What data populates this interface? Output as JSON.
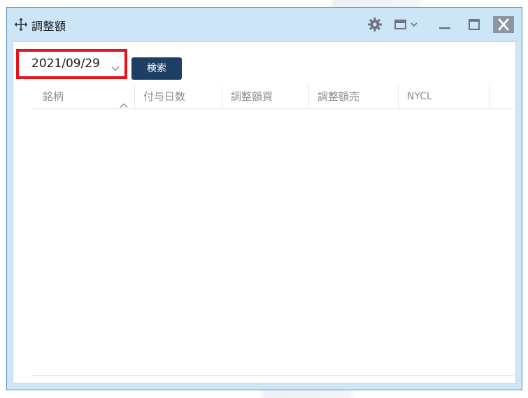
{
  "window": {
    "title": "調整額"
  },
  "icons": {
    "move": "move-icon",
    "gear": "gear-icon",
    "layout": "window-layout-icon",
    "minimize": "minimize-icon",
    "maximize": "maximize-icon",
    "close": "close-icon",
    "date_dropdown": "chevron-down-icon",
    "sort": "chevron-up-icon"
  },
  "controls": {
    "date_value": "2021/09/29",
    "search_label": "検索"
  },
  "table": {
    "columns": [
      "銘柄",
      "付与日数",
      "調整額買",
      "調整額売",
      "NYCL"
    ],
    "sort_column": "銘柄",
    "rows": []
  },
  "colors": {
    "highlight_border": "#e8121a",
    "search_button_bg": "#1e3f63",
    "titlebar_bg": "#cde6f7"
  }
}
